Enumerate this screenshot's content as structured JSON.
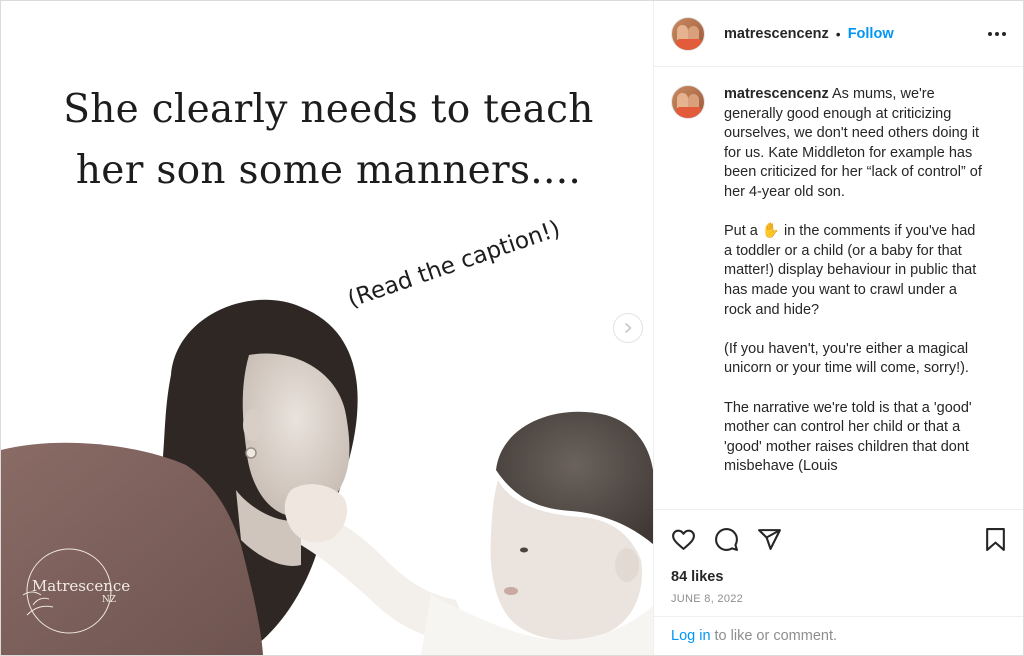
{
  "post": {
    "headline": "She clearly needs to teach her son some manners....",
    "handwritten_note": "(Read the caption!)",
    "watermark": {
      "title": "Matrescence",
      "subtitle": "NZ"
    },
    "carousel": {
      "slide_count": 5,
      "active_index": 0
    }
  },
  "header": {
    "username": "matrescencenz",
    "separator": "•",
    "follow_label": "Follow"
  },
  "caption": {
    "username": "matrescencenz",
    "text": " As mums, we're generally good enough at criticizing ourselves, we don't need others doing it for us. Kate Middleton for example has been criticized for her “lack of control” of her 4-year old son.\n\nPut a ✋ in the comments if you've had a toddler or a child (or a baby for that matter!) display behaviour in public that has made you want to crawl under a rock and hide?\n\n(If you haven't, you're either a magical unicorn or your time will come, sorry!).\n\nThe narrative we're told is that a 'good' mother can control her child or that a 'good' mother raises children that dont misbehave (Louis"
  },
  "stats": {
    "likes": "84 likes",
    "date": "JUNE 8, 2022"
  },
  "footer": {
    "login_label": "Log in",
    "suffix": "to like or comment."
  },
  "icons": {
    "like": "heart-icon",
    "comment": "comment-icon",
    "share": "share-icon",
    "save": "bookmark-icon",
    "more": "more-icon",
    "next": "chevron-right-icon"
  },
  "colors": {
    "link": "#0095f6",
    "muted": "#8e8e8e",
    "text": "#262626"
  }
}
